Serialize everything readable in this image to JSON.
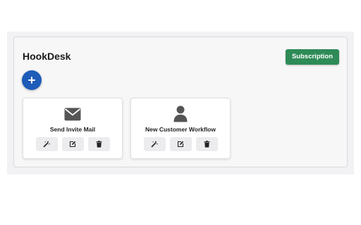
{
  "app": {
    "title": "HookDesk"
  },
  "header": {
    "subscription_label": "Subscription"
  },
  "add_button": {
    "label": "+"
  },
  "colors": {
    "primary_green": "#2e8b57",
    "primary_blue": "#1d5cb8",
    "icon_gray": "#555555"
  },
  "workflows": [
    {
      "title": "Send Invite Mail",
      "icon": "envelope-icon",
      "actions": [
        "magic-wand-icon",
        "edit-icon",
        "trash-icon"
      ]
    },
    {
      "title": "New Customer Workflow",
      "icon": "person-icon",
      "actions": [
        "magic-wand-icon",
        "edit-icon",
        "trash-icon"
      ]
    }
  ]
}
